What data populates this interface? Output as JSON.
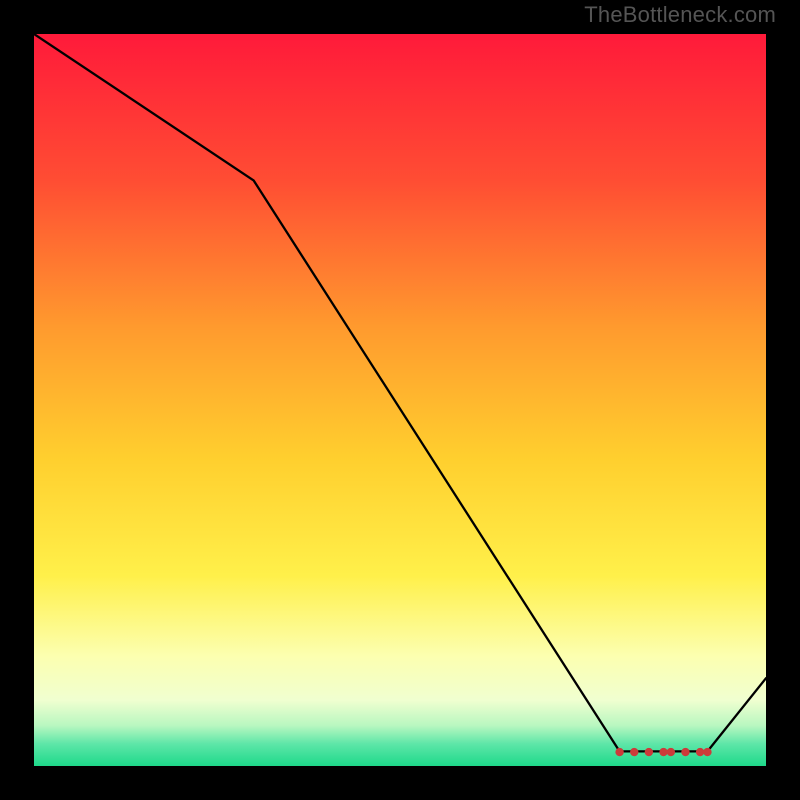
{
  "watermark": "TheBottleneck.com",
  "chart_data": {
    "type": "line",
    "title": "",
    "xlabel": "",
    "ylabel": "",
    "xlim": [
      0,
      100
    ],
    "ylim": [
      0,
      100
    ],
    "grid": false,
    "legend": false,
    "x": [
      0,
      30,
      80,
      92,
      100
    ],
    "values": [
      100,
      80,
      2,
      2,
      12
    ],
    "markers": {
      "x": [
        80,
        82,
        84,
        86,
        87,
        89,
        91,
        92
      ],
      "y": [
        1.9,
        1.9,
        1.9,
        1.9,
        1.9,
        1.9,
        1.9,
        1.9
      ]
    },
    "background_gradient": {
      "stops": [
        {
          "offset": 0.0,
          "color": "#ff1a3a"
        },
        {
          "offset": 0.2,
          "color": "#ff4d33"
        },
        {
          "offset": 0.4,
          "color": "#ff9a2e"
        },
        {
          "offset": 0.58,
          "color": "#ffcf2e"
        },
        {
          "offset": 0.74,
          "color": "#fff04a"
        },
        {
          "offset": 0.85,
          "color": "#fcffb0"
        },
        {
          "offset": 0.91,
          "color": "#f0ffd0"
        },
        {
          "offset": 0.945,
          "color": "#b8f7c0"
        },
        {
          "offset": 0.97,
          "color": "#5de6a8"
        },
        {
          "offset": 1.0,
          "color": "#1ed98a"
        }
      ]
    },
    "line_color": "#000000",
    "marker_color": "#cc3a3a"
  }
}
